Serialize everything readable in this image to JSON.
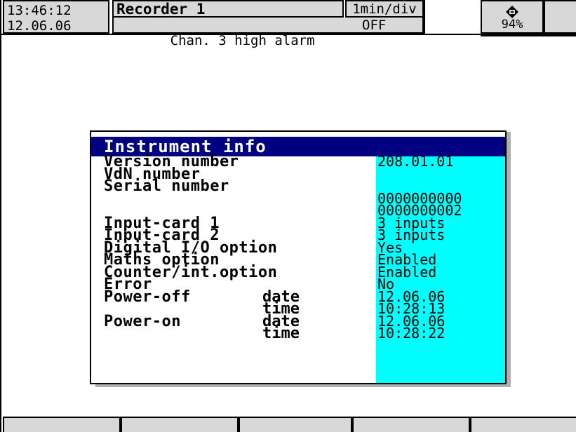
{
  "header": {
    "time": "13:46:12",
    "date": "12.06.06",
    "recorder_title": "Recorder 1",
    "rate": "1min/div",
    "status_text": "Chan. 3 high alarm",
    "status_value": "OFF",
    "card_icon": "cf-card-icon",
    "card_percent": "94%"
  },
  "dialog": {
    "title": "Instrument info",
    "rows": [
      {
        "label": "Version number",
        "sub": "",
        "value": "208.01.01"
      },
      {
        "label": "VdN number",
        "sub": "",
        "value": ""
      },
      {
        "label": "Serial number",
        "sub": "",
        "value": ""
      },
      {
        "label": "",
        "sub": "",
        "value": "0000000000"
      },
      {
        "label": "",
        "sub": "",
        "value": "0000000002"
      },
      {
        "label": "Input-card 1",
        "sub": "",
        "value": "3 inputs"
      },
      {
        "label": "Input-card 2",
        "sub": "",
        "value": "3 inputs"
      },
      {
        "label": "Digital I/O option",
        "sub": "",
        "value": "Yes"
      },
      {
        "label": "Maths option",
        "sub": "",
        "value": "Enabled"
      },
      {
        "label": "Counter/int.option",
        "sub": "",
        "value": "Enabled"
      },
      {
        "label": "Error",
        "sub": "",
        "value": "No"
      },
      {
        "label": "Power-off",
        "sub": "date",
        "value": "12.06.06"
      },
      {
        "label": "",
        "sub": "time",
        "value": "10:28:13"
      },
      {
        "label": "Power-on",
        "sub": "date",
        "value": "12.06.06"
      },
      {
        "label": "",
        "sub": "time",
        "value": "10:28:22"
      }
    ]
  },
  "softkeys": [
    "",
    "",
    "",
    "",
    ""
  ],
  "colors": {
    "title_bar": "#000080",
    "value_column": "#00ffff",
    "panel_gray": "#d8d8d8"
  }
}
